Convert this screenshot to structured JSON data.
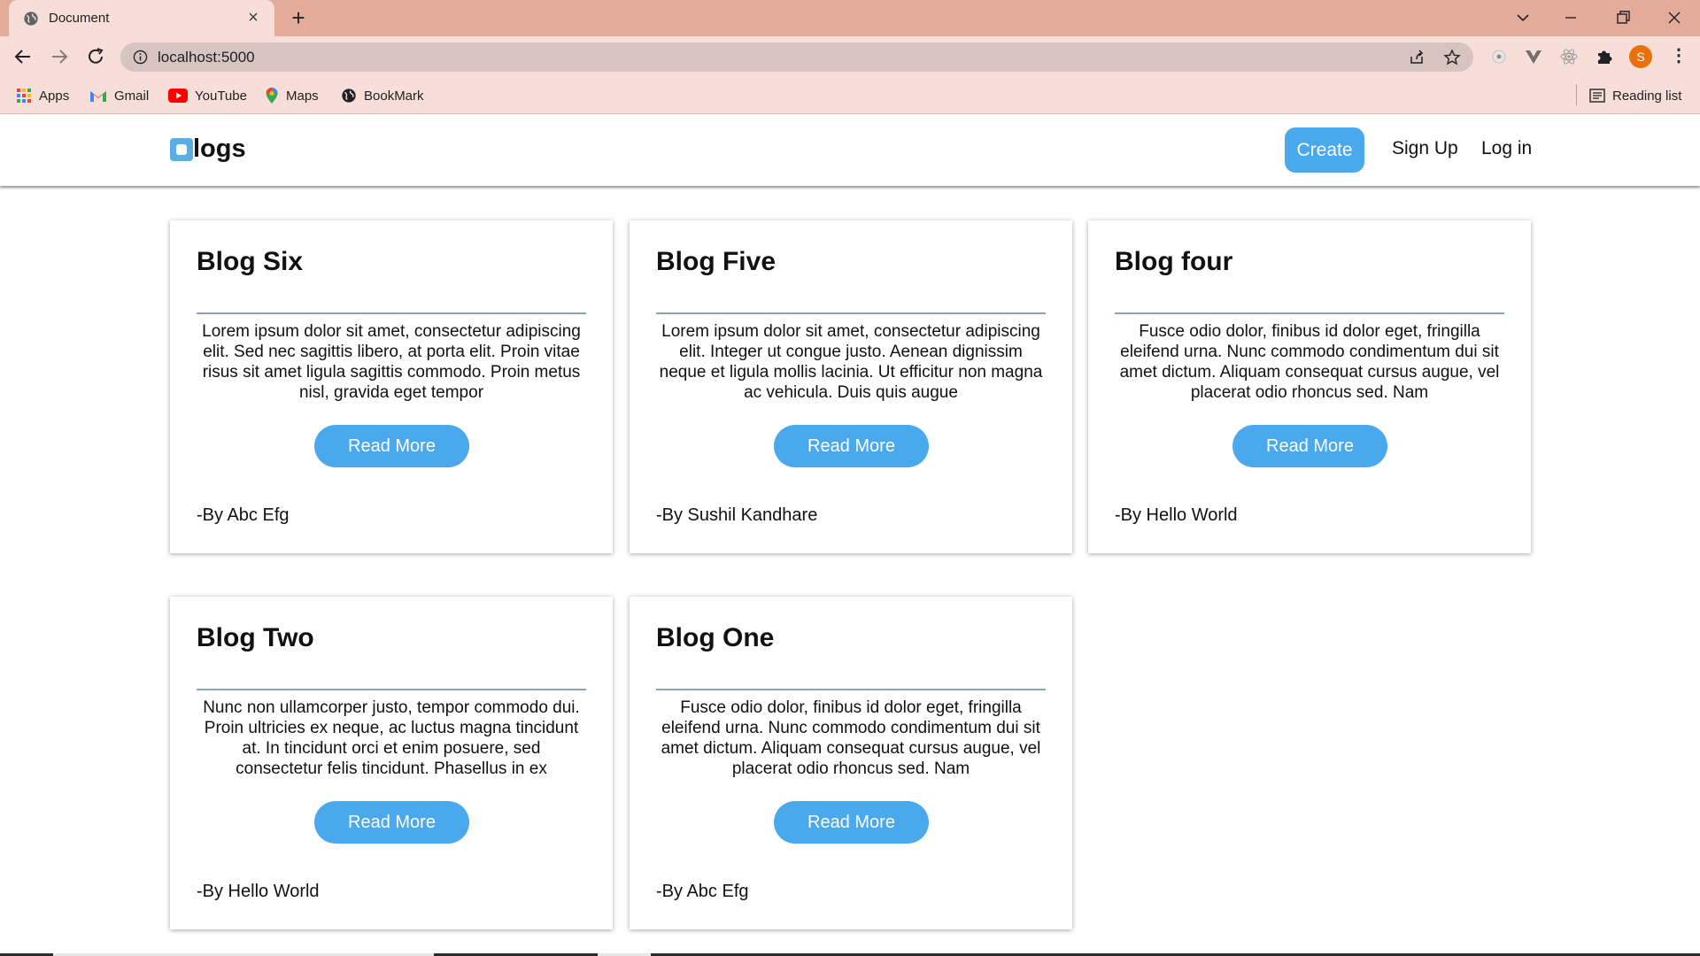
{
  "browser": {
    "tab_title": "Document",
    "url": "localhost:5000",
    "bookmarks": [
      {
        "label": "Apps",
        "icon": "apps-grid-icon"
      },
      {
        "label": "Gmail",
        "icon": "gmail-icon"
      },
      {
        "label": "YouTube",
        "icon": "youtube-icon"
      },
      {
        "label": "Maps",
        "icon": "maps-icon"
      },
      {
        "label": "BookMark",
        "icon": "globe-icon"
      }
    ],
    "reading_list": "Reading list",
    "profile_initial": "S"
  },
  "site": {
    "logo_text": "logs",
    "nav": {
      "create": "Create",
      "sign_up": "Sign Up",
      "log_in": "Log in"
    },
    "accent_color": "#4aa8ec",
    "blogs": [
      {
        "title": "Blog Six",
        "snippet": "Lorem ipsum dolor sit amet, consectetur adipiscing elit. Sed nec sagittis libero, at porta elit. Proin vitae risus sit amet ligula sagittis commodo. Proin metus nisl, gravida eget tempor",
        "button": "Read More",
        "author": "-By Abc Efg"
      },
      {
        "title": "Blog Five",
        "snippet": "Lorem ipsum dolor sit amet, consectetur adipiscing elit. Integer ut congue justo. Aenean dignissim neque et ligula mollis lacinia. Ut efficitur non magna ac vehicula. Duis quis augue",
        "button": "Read More",
        "author": "-By Sushil Kandhare"
      },
      {
        "title": "Blog four",
        "snippet": "Fusce odio dolor, finibus id dolor eget, fringilla eleifend urna. Nunc commodo condimentum dui sit amet dictum. Aliquam consequat cursus augue, vel placerat odio rhoncus sed. Nam",
        "button": "Read More",
        "author": "-By Hello World"
      },
      {
        "title": "Blog Two",
        "snippet": "Nunc non ullamcorper justo, tempor commodo dui. Proin ultricies ex neque, ac luctus magna tincidunt at. In tincidunt orci et enim posuere, sed consectetur felis tincidunt. Phasellus in ex",
        "button": "Read More",
        "author": "-By Hello World"
      },
      {
        "title": "Blog One",
        "snippet": "Fusce odio dolor, finibus id dolor eget, fringilla eleifend urna. Nunc commodo condimentum dui sit amet dictum. Aliquam consequat cursus augue, vel placerat odio rhoncus sed. Nam",
        "button": "Read More",
        "author": "-By Abc Efg"
      }
    ]
  }
}
